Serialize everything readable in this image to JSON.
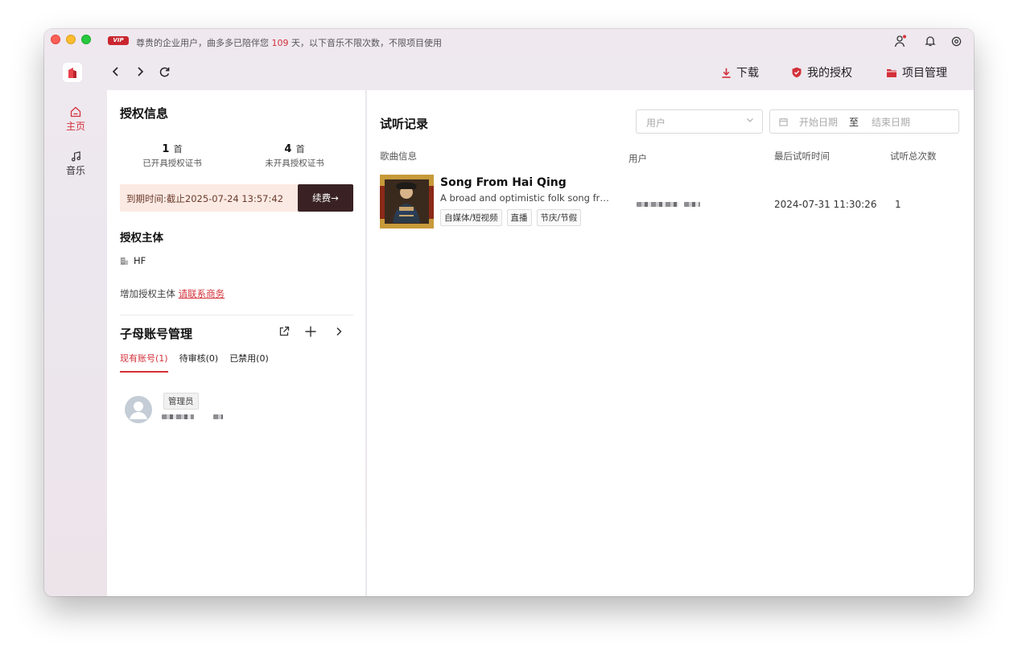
{
  "titlebar": {
    "vip_badge": "VIP",
    "notice_prefix": "尊贵的企业用户，曲多多已陪伴您 ",
    "notice_days": "109",
    "notice_suffix": " 天，以下音乐不限次数，不限项目使用"
  },
  "navbar": {
    "actions": [
      {
        "label": "下载",
        "icon": "download-icon"
      },
      {
        "label": "我的授权",
        "icon": "shield-icon"
      },
      {
        "label": "项目管理",
        "icon": "folder-icon"
      }
    ],
    "accent": "#d3313a"
  },
  "rail": {
    "items": [
      {
        "label": "主页",
        "icon": "home-icon",
        "active": true
      },
      {
        "label": "音乐",
        "icon": "music-note-icon",
        "active": false
      }
    ]
  },
  "license": {
    "title": "授权信息",
    "issued": {
      "count": "1",
      "unit": "首",
      "label": "已开具授权证书"
    },
    "not_issued": {
      "count": "4",
      "unit": "首",
      "label": "未开具授权证书"
    },
    "expire_text": "到期时间:截止2025-07-24 13:57:42",
    "renew_label": "续费→",
    "subject_title": "授权主体",
    "subject_name": "HF",
    "add_subject_text": "增加授权主体 ",
    "add_subject_link": "请联系商务"
  },
  "sub_accounts": {
    "title": "子母账号管理",
    "tabs": [
      {
        "label": "现有账号(1)",
        "active": true
      },
      {
        "label": "待审核(0)",
        "active": false
      },
      {
        "label": "已禁用(0)",
        "active": false
      }
    ],
    "accounts": [
      {
        "role": "管理员"
      }
    ]
  },
  "listen_records": {
    "title": "试听记录",
    "user_filter_placeholder": "用户",
    "start_date_placeholder": "开始日期",
    "date_separator": "至",
    "end_date_placeholder": "结束日期",
    "columns": [
      "歌曲信息",
      "用户",
      "最后试听时间",
      "试听总次数"
    ],
    "rows": [
      {
        "title": "Song From Hai Qing",
        "description": "A broad and optimistic folk song fr…",
        "tags": [
          "自媒体/短视频",
          "直播",
          "节庆/节假"
        ],
        "last_listen": "2024-07-31 11:30:26",
        "total": "1"
      }
    ]
  }
}
